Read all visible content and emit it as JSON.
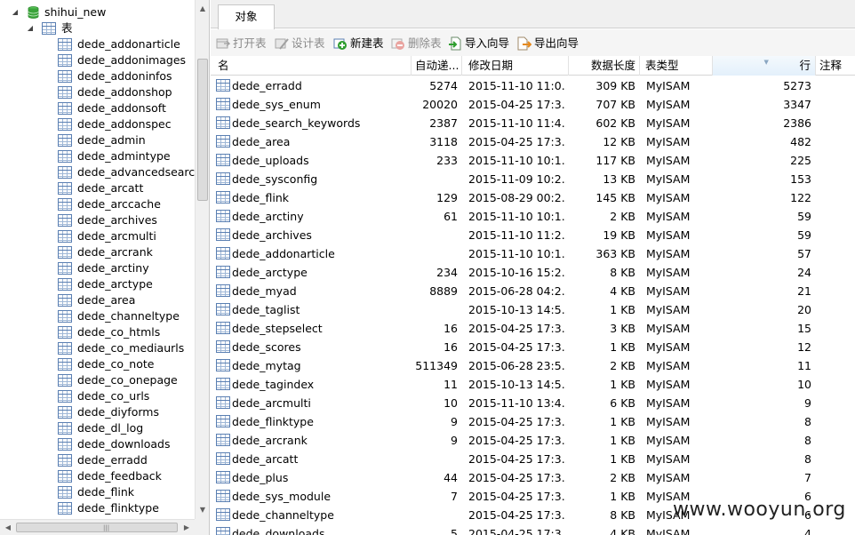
{
  "tree": {
    "database": "shihui_new",
    "tables_node": "表",
    "items": [
      "dede_addonarticle",
      "dede_addonimages",
      "dede_addoninfos",
      "dede_addonshop",
      "dede_addonsoft",
      "dede_addonspec",
      "dede_admin",
      "dede_admintype",
      "dede_advancedsearch",
      "dede_arcatt",
      "dede_arccache",
      "dede_archives",
      "dede_arcmulti",
      "dede_arcrank",
      "dede_arctiny",
      "dede_arctype",
      "dede_area",
      "dede_channeltype",
      "dede_co_htmls",
      "dede_co_mediaurls",
      "dede_co_note",
      "dede_co_onepage",
      "dede_co_urls",
      "dede_diyforms",
      "dede_dl_log",
      "dede_downloads",
      "dede_erradd",
      "dede_feedback",
      "dede_flink",
      "dede_flinktype"
    ]
  },
  "tab": {
    "label": "对象"
  },
  "toolbar": {
    "open": "打开表",
    "design": "设计表",
    "new": "新建表",
    "delete": "删除表",
    "import": "导入向导",
    "export": "导出向导"
  },
  "columns": {
    "name": "名",
    "autoinc": "自动递...",
    "modified": "修改日期",
    "datalen": "数据长度",
    "engine": "表类型",
    "rows": "行",
    "comment": "注释"
  },
  "rows": [
    {
      "name": "dede_erradd",
      "autoinc": "5274",
      "modified": "2015-11-10 11:0...",
      "datalen": "309 KB",
      "engine": "MyISAM",
      "rows": "5273"
    },
    {
      "name": "dede_sys_enum",
      "autoinc": "20020",
      "modified": "2015-04-25 17:3...",
      "datalen": "707 KB",
      "engine": "MyISAM",
      "rows": "3347"
    },
    {
      "name": "dede_search_keywords",
      "autoinc": "2387",
      "modified": "2015-11-10 11:4...",
      "datalen": "602 KB",
      "engine": "MyISAM",
      "rows": "2386"
    },
    {
      "name": "dede_area",
      "autoinc": "3118",
      "modified": "2015-04-25 17:3...",
      "datalen": "12 KB",
      "engine": "MyISAM",
      "rows": "482"
    },
    {
      "name": "dede_uploads",
      "autoinc": "233",
      "modified": "2015-11-10 10:1...",
      "datalen": "117 KB",
      "engine": "MyISAM",
      "rows": "225"
    },
    {
      "name": "dede_sysconfig",
      "autoinc": "",
      "modified": "2015-11-09 10:2...",
      "datalen": "13 KB",
      "engine": "MyISAM",
      "rows": "153"
    },
    {
      "name": "dede_flink",
      "autoinc": "129",
      "modified": "2015-08-29 00:2...",
      "datalen": "145 KB",
      "engine": "MyISAM",
      "rows": "122"
    },
    {
      "name": "dede_arctiny",
      "autoinc": "61",
      "modified": "2015-11-10 10:1...",
      "datalen": "2 KB",
      "engine": "MyISAM",
      "rows": "59"
    },
    {
      "name": "dede_archives",
      "autoinc": "",
      "modified": "2015-11-10 11:2...",
      "datalen": "19 KB",
      "engine": "MyISAM",
      "rows": "59"
    },
    {
      "name": "dede_addonarticle",
      "autoinc": "",
      "modified": "2015-11-10 10:1...",
      "datalen": "363 KB",
      "engine": "MyISAM",
      "rows": "57"
    },
    {
      "name": "dede_arctype",
      "autoinc": "234",
      "modified": "2015-10-16 15:2...",
      "datalen": "8 KB",
      "engine": "MyISAM",
      "rows": "24"
    },
    {
      "name": "dede_myad",
      "autoinc": "8889",
      "modified": "2015-06-28 04:2...",
      "datalen": "4 KB",
      "engine": "MyISAM",
      "rows": "21"
    },
    {
      "name": "dede_taglist",
      "autoinc": "",
      "modified": "2015-10-13 14:5...",
      "datalen": "1 KB",
      "engine": "MyISAM",
      "rows": "20"
    },
    {
      "name": "dede_stepselect",
      "autoinc": "16",
      "modified": "2015-04-25 17:3...",
      "datalen": "3 KB",
      "engine": "MyISAM",
      "rows": "15"
    },
    {
      "name": "dede_scores",
      "autoinc": "16",
      "modified": "2015-04-25 17:3...",
      "datalen": "1 KB",
      "engine": "MyISAM",
      "rows": "12"
    },
    {
      "name": "dede_mytag",
      "autoinc": "511349",
      "modified": "2015-06-28 23:5...",
      "datalen": "2 KB",
      "engine": "MyISAM",
      "rows": "11"
    },
    {
      "name": "dede_tagindex",
      "autoinc": "11",
      "modified": "2015-10-13 14:5...",
      "datalen": "1 KB",
      "engine": "MyISAM",
      "rows": "10"
    },
    {
      "name": "dede_arcmulti",
      "autoinc": "10",
      "modified": "2015-11-10 13:4...",
      "datalen": "6 KB",
      "engine": "MyISAM",
      "rows": "9"
    },
    {
      "name": "dede_flinktype",
      "autoinc": "9",
      "modified": "2015-04-25 17:3...",
      "datalen": "1 KB",
      "engine": "MyISAM",
      "rows": "8"
    },
    {
      "name": "dede_arcrank",
      "autoinc": "9",
      "modified": "2015-04-25 17:3...",
      "datalen": "1 KB",
      "engine": "MyISAM",
      "rows": "8"
    },
    {
      "name": "dede_arcatt",
      "autoinc": "",
      "modified": "2015-04-25 17:3...",
      "datalen": "1 KB",
      "engine": "MyISAM",
      "rows": "8"
    },
    {
      "name": "dede_plus",
      "autoinc": "44",
      "modified": "2015-04-25 17:3...",
      "datalen": "2 KB",
      "engine": "MyISAM",
      "rows": "7"
    },
    {
      "name": "dede_sys_module",
      "autoinc": "7",
      "modified": "2015-04-25 17:3...",
      "datalen": "1 KB",
      "engine": "MyISAM",
      "rows": "6"
    },
    {
      "name": "dede_channeltype",
      "autoinc": "",
      "modified": "2015-04-25 17:3...",
      "datalen": "8 KB",
      "engine": "MyISAM",
      "rows": "6"
    },
    {
      "name": "dede_downloads",
      "autoinc": "5",
      "modified": "2015-04-25 17:3...",
      "datalen": "4 KB",
      "engine": "MyISAM",
      "rows": "4"
    }
  ],
  "watermark": "www.wooyun.org",
  "colors": {
    "db_icon": "#3aa33a",
    "table_icon": "#5a7fb2",
    "new_icon": "#2f9e2f",
    "delete_icon": "#d8504a",
    "import_icon": "#3c8a3c",
    "export_icon": "#e58a1f"
  }
}
